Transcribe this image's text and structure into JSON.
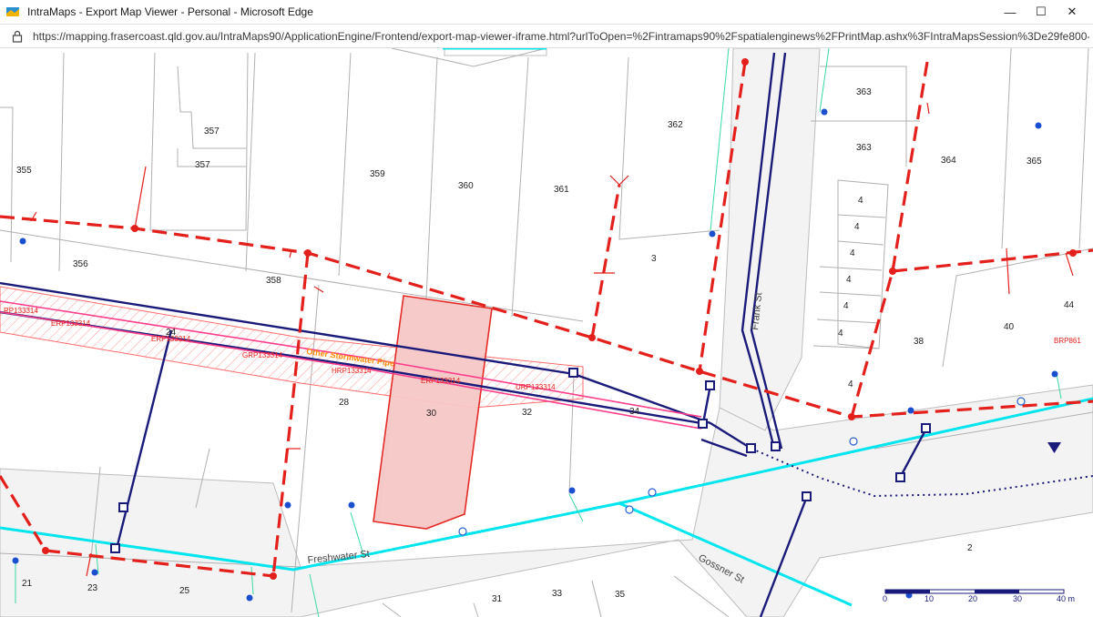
{
  "window": {
    "title": "IntraMaps - Export Map Viewer - Personal - Microsoft Edge",
    "minimize": "—",
    "maximize": "☐",
    "close": "✕"
  },
  "address": {
    "url": "https://mapping.frasercoast.qld.gov.au/IntraMaps90/ApplicationEngine/Frontend/export-map-viewer-iframe.html?urlToOpen=%2Fintramaps90%2Fspatialenginews%2FPrintMap.ashx%3FIntraMapsSession%3De29fe800-ca..."
  },
  "map": {
    "streets": [
      "Freshwater St",
      "Gossner St",
      "Frank St"
    ],
    "lots": [
      "355",
      "356",
      "357",
      "357",
      "358",
      "359",
      "360",
      "361",
      "362",
      "363",
      "363",
      "364",
      "365",
      "3",
      "4",
      "4",
      "4",
      "4",
      "4",
      "4",
      "4",
      "38",
      "40",
      "44",
      "28",
      "30",
      "32",
      "34",
      "24",
      "21",
      "23",
      "25",
      "31",
      "33",
      "35",
      "2"
    ],
    "pipe_label": "Other Stormwater Pipe",
    "easement_labels": [
      "RP133314",
      "ERP133314",
      "ERP133314",
      "GRP133314",
      "HRP133314",
      "ERP133314",
      "URP133314",
      "BRP861"
    ],
    "scale": {
      "ticks": [
        "0",
        "10",
        "20",
        "30",
        "40 m"
      ]
    },
    "colors": {
      "sewer": "#e3201b",
      "water": "#1a1a7a",
      "stormwater": "#00e5ee",
      "easement": "#ff3d8a",
      "highlight": "#f7c8c8"
    }
  }
}
